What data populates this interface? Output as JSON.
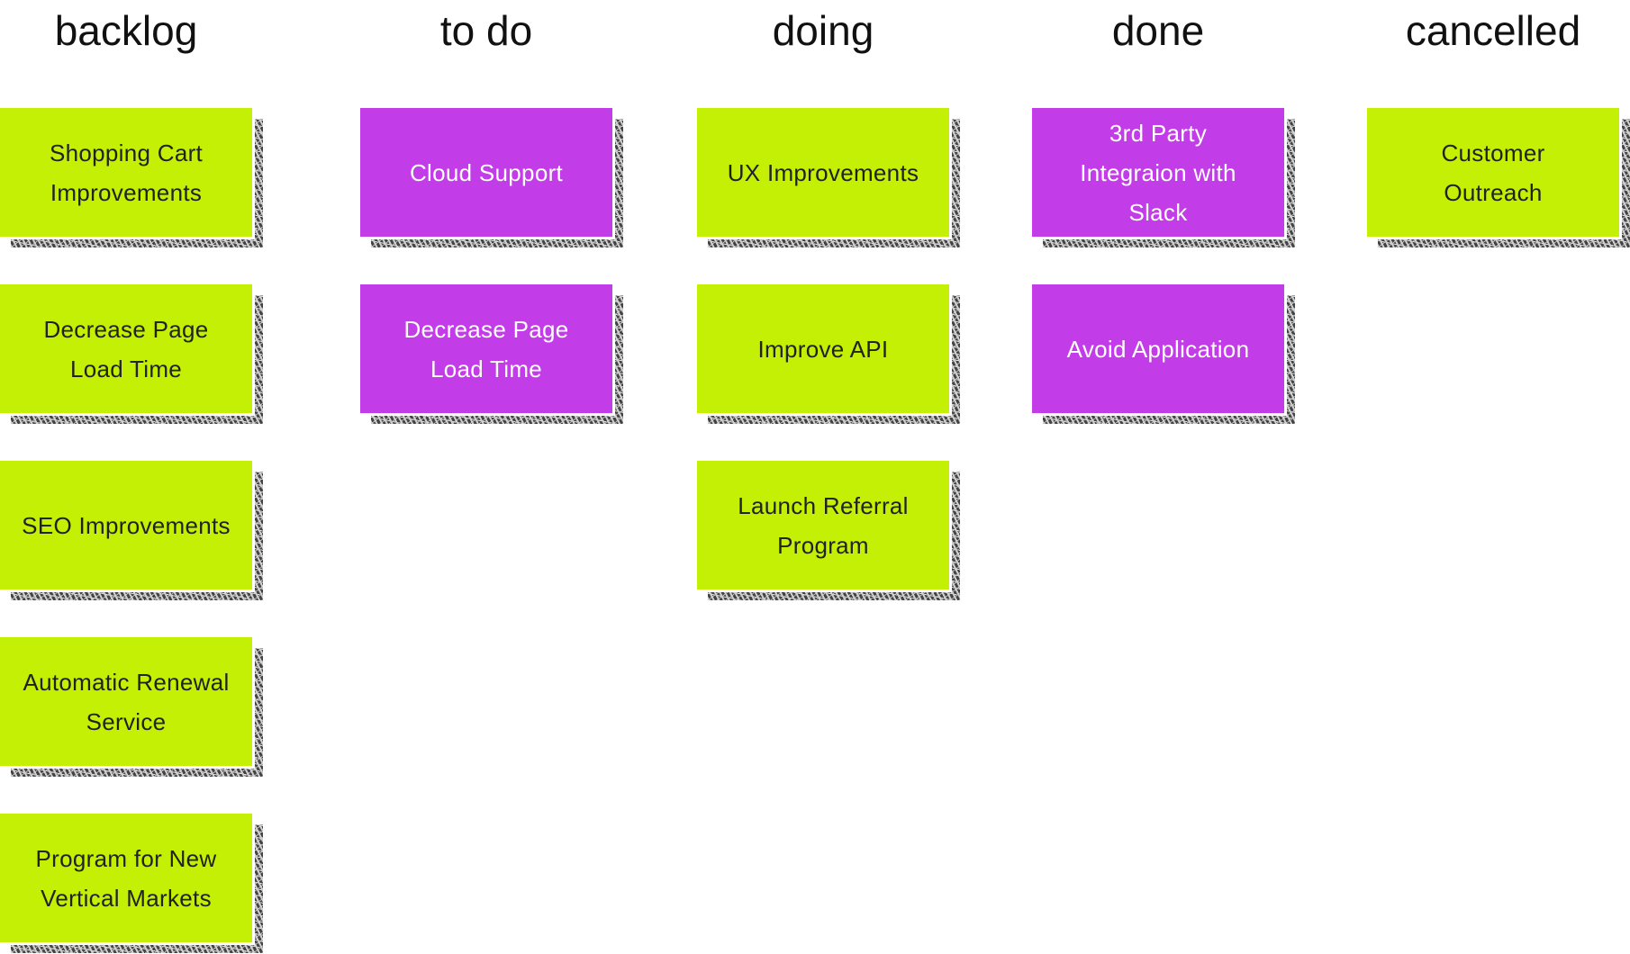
{
  "colors": {
    "green": "#c3f004",
    "purple": "#c23ce8",
    "text_dark": "#222222",
    "text_light": "#ffffff"
  },
  "columns": [
    {
      "title": "backlog",
      "cards": [
        {
          "label": "Shopping Cart Improvements",
          "color": "green"
        },
        {
          "label": "Decrease Page Load Time",
          "color": "green"
        },
        {
          "label": "SEO Improvements",
          "color": "green"
        },
        {
          "label": "Automatic Renewal Service",
          "color": "green"
        },
        {
          "label": "Program for New Vertical Markets",
          "color": "green"
        }
      ]
    },
    {
      "title": "to do",
      "cards": [
        {
          "label": "Cloud Support",
          "color": "purple"
        },
        {
          "label": "Decrease Page Load Time",
          "color": "purple"
        }
      ]
    },
    {
      "title": "doing",
      "cards": [
        {
          "label": "UX Improvements",
          "color": "green"
        },
        {
          "label": "Improve API",
          "color": "green"
        },
        {
          "label": "Launch Referral Program",
          "color": "green"
        }
      ]
    },
    {
      "title": "done",
      "cards": [
        {
          "label": "3rd Party Integraion with Slack",
          "color": "purple"
        },
        {
          "label": "Avoid Application",
          "color": "purple"
        }
      ]
    },
    {
      "title": "cancelled",
      "cards": [
        {
          "label": "Customer Outreach",
          "color": "green"
        }
      ]
    }
  ]
}
